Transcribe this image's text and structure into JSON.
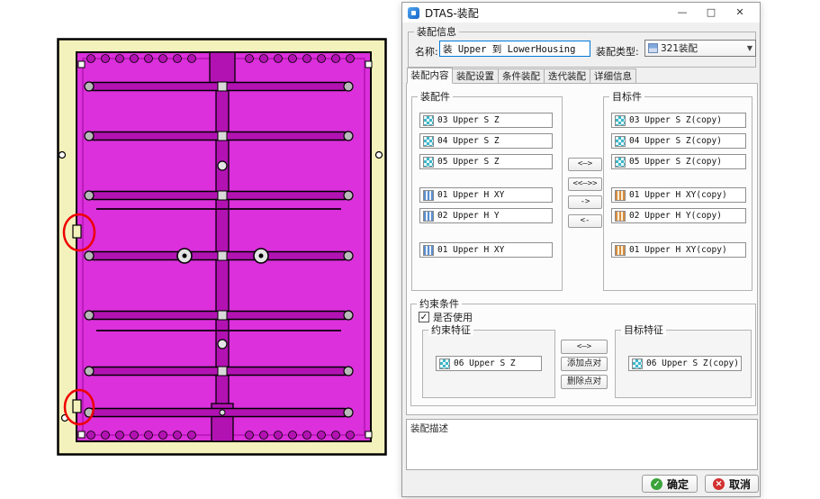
{
  "colors": {
    "magenta": "#DB30DB",
    "magenta_dark": "#B312B3",
    "yellow": "#F4F2BC",
    "red_annotation": "#EE0000",
    "accent_blue": "#0078D7",
    "teal_icon": "#3EB6C8",
    "teal_icon_bg": "#E6F7FA",
    "blue_icon": "#5A8FD0",
    "blue_icon_bg": "#E8F0FB",
    "orange_icon": "#D98E3F",
    "orange_icon_bg": "#FBEFD9",
    "ok_green": "#3BA33B",
    "cancel_red": "#D23030"
  },
  "dialog": {
    "title": "DTAS-装配",
    "window_buttons": {
      "minimize": "—",
      "maximize": "□",
      "close": "✕"
    },
    "info": {
      "legend": "装配信息",
      "name_label": "名称:",
      "name_value": "装 Upper 到 LowerHousing",
      "type_label": "装配类型:",
      "type_value": "321装配",
      "type_arrow": "▼"
    },
    "tabs": [
      {
        "label": "装配内容"
      },
      {
        "label": "装配设置"
      },
      {
        "label": "条件装配"
      },
      {
        "label": "迭代装配"
      },
      {
        "label": "详细信息"
      }
    ],
    "assembly": {
      "legend": "装配件",
      "items": [
        {
          "label": "03 Upper S Z",
          "icon": "grid"
        },
        {
          "label": "04 Upper S Z",
          "icon": "grid"
        },
        {
          "label": "05 Upper S Z",
          "icon": "grid"
        },
        {
          "label": "01 Upper H XY",
          "icon": "bars-blue"
        },
        {
          "label": "02 Upper H Y",
          "icon": "bars-blue"
        },
        {
          "label": "01 Upper H XY",
          "icon": "bars-blue"
        }
      ]
    },
    "target": {
      "legend": "目标件",
      "items": [
        {
          "label": "03 Upper S Z(copy)",
          "icon": "grid"
        },
        {
          "label": "04 Upper S Z(copy)",
          "icon": "grid"
        },
        {
          "label": "05 Upper S Z(copy)",
          "icon": "grid"
        },
        {
          "label": "01 Upper H XY(copy)",
          "icon": "bars-orange"
        },
        {
          "label": "02 Upper H Y(copy)",
          "icon": "bars-orange"
        },
        {
          "label": "01 Upper H XY(copy)",
          "icon": "bars-orange"
        }
      ]
    },
    "transfer_buttons": [
      "<—>",
      "<<—>>",
      "->",
      "<-"
    ],
    "constraint": {
      "legend": "约束条件",
      "use_label": "是否使用",
      "check_glyph": "✓",
      "feature": {
        "legend": "约束特征",
        "item": "06 Upper S Z",
        "item_icon": "grid"
      },
      "target_feature": {
        "legend": "目标特征",
        "item": "06 Upper S Z(copy)",
        "item_icon": "grid"
      },
      "buttons": [
        "<—>",
        "添加点对",
        "删除点对"
      ]
    },
    "description": {
      "legend": "装配描述"
    },
    "footer": {
      "ok": "确定",
      "ok_icon": "✓",
      "cancel": "取消",
      "cancel_icon": "✕"
    }
  }
}
